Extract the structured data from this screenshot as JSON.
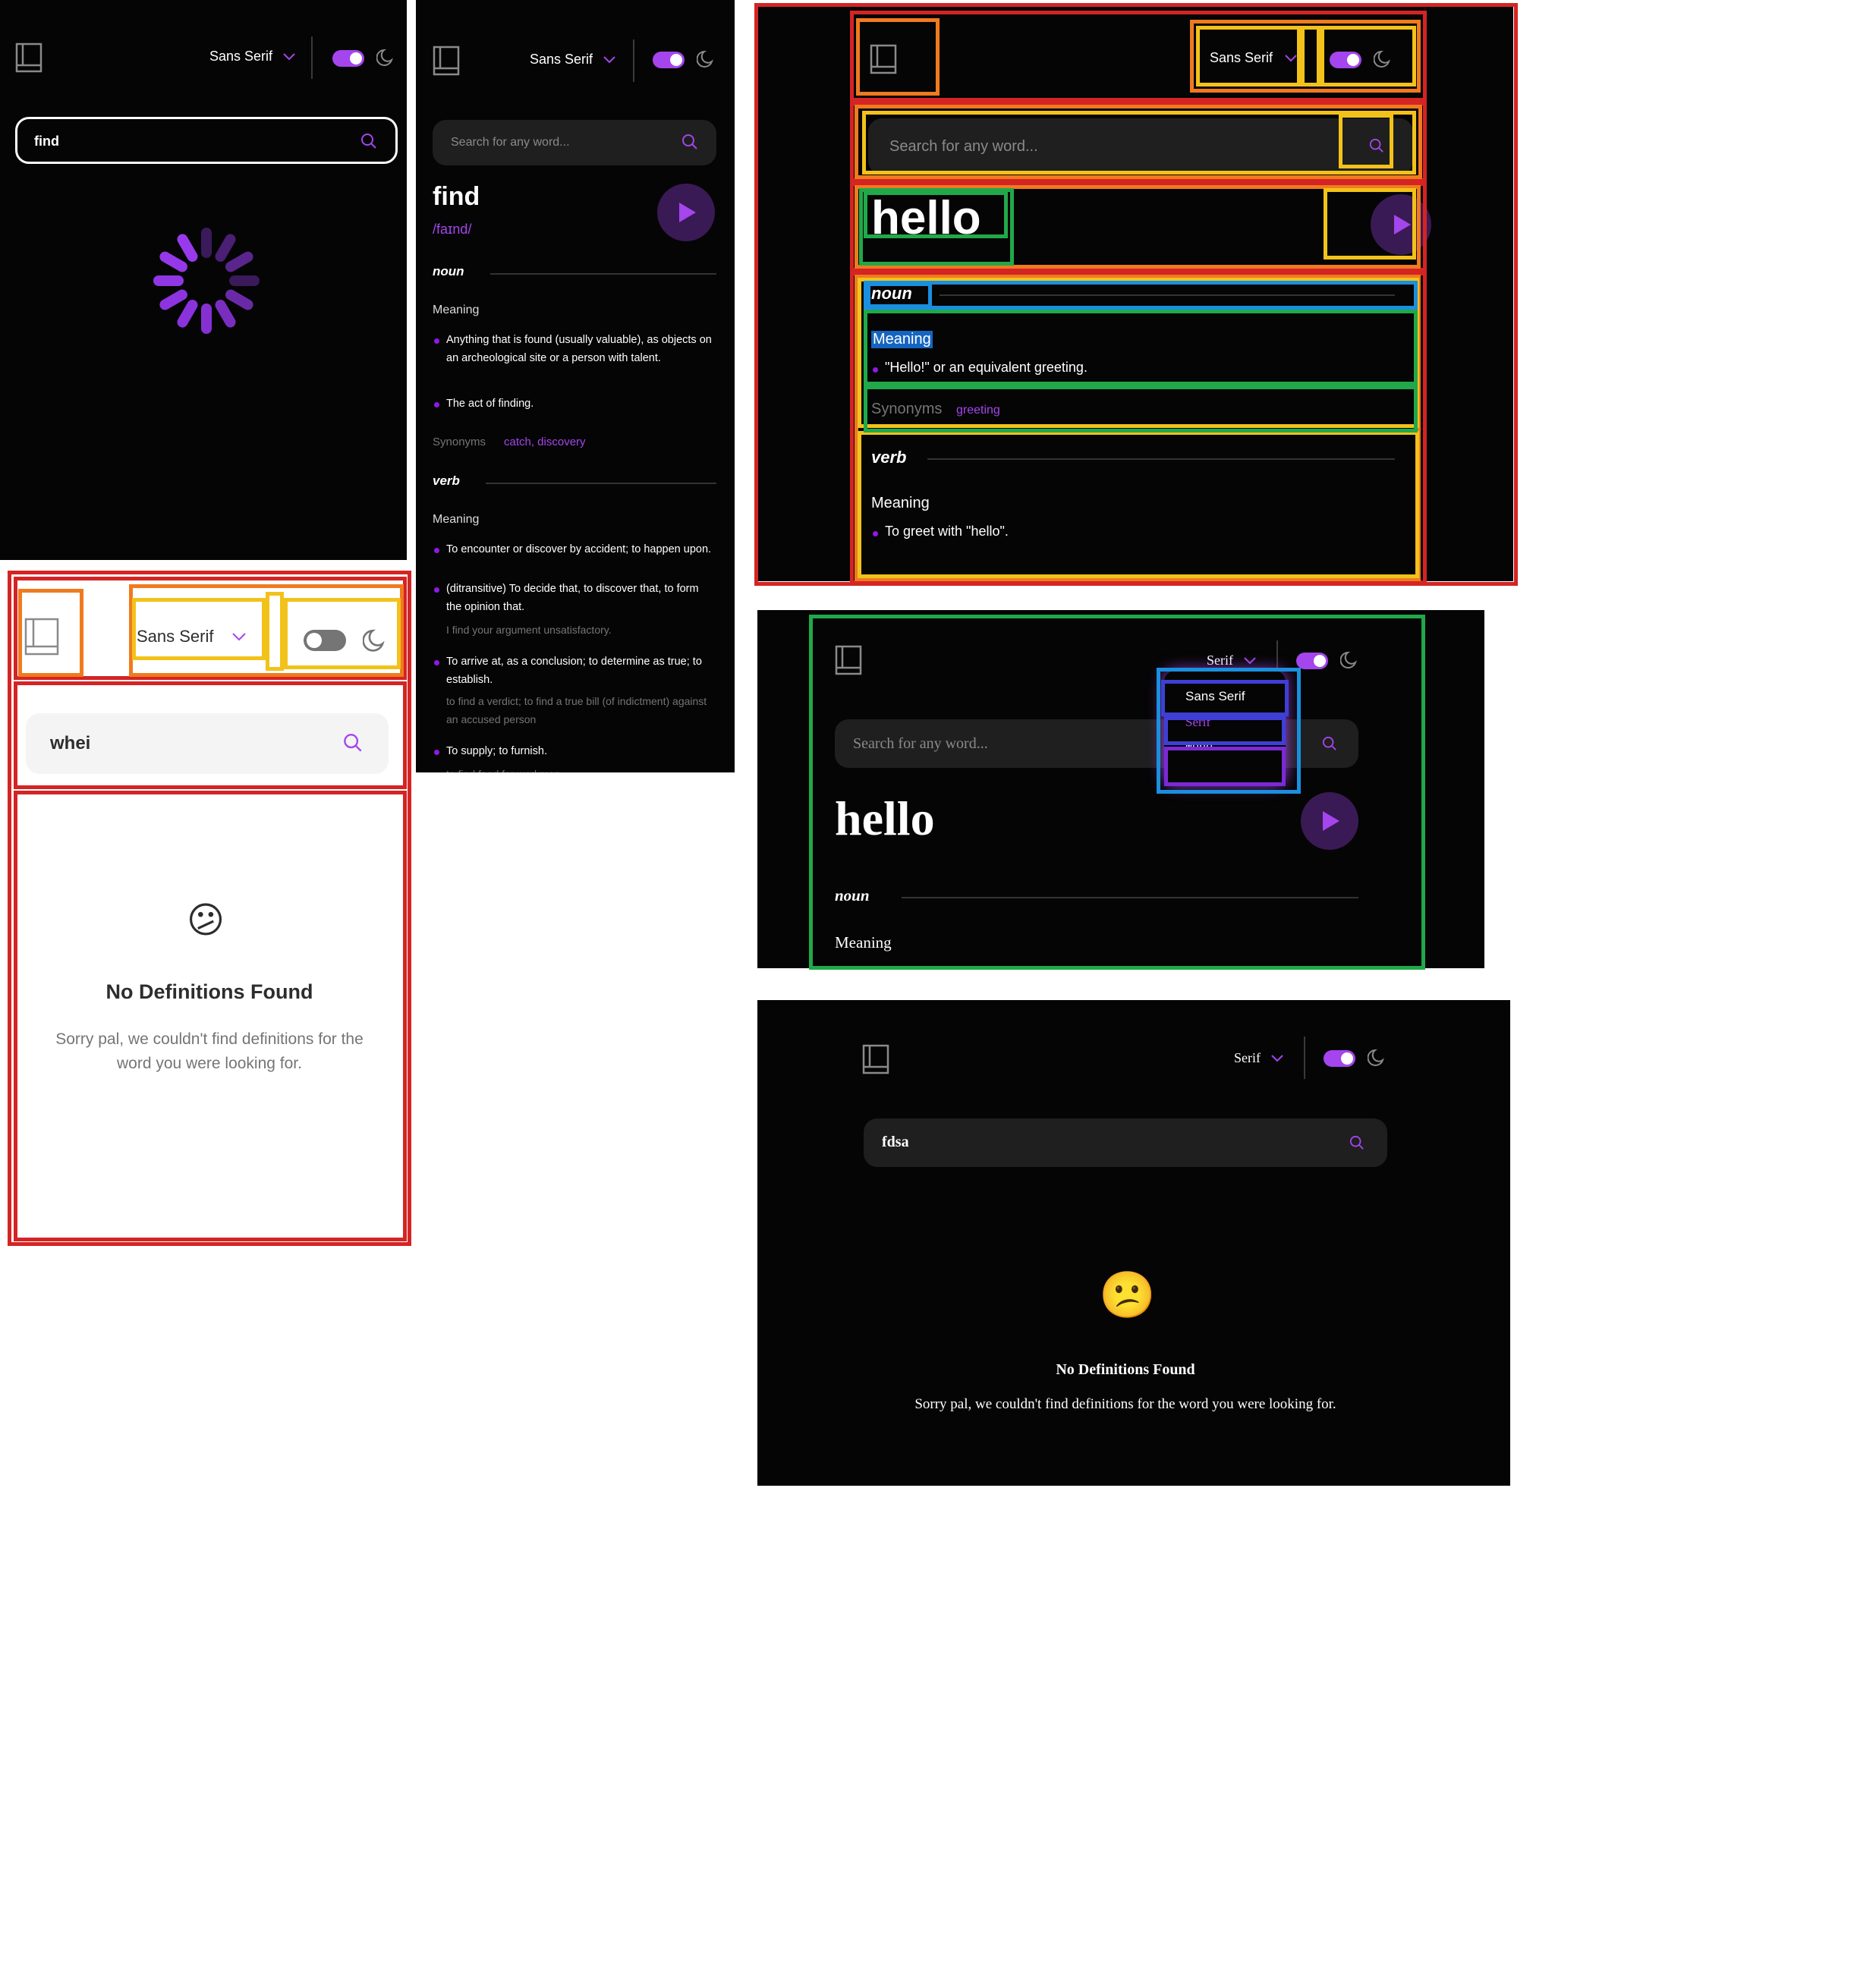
{
  "panel1": {
    "font_label": "Sans Serif",
    "search_value": "find",
    "icons": [
      "book-icon",
      "chevron-down-icon",
      "moon-icon",
      "search-icon",
      "loading-spinner-icon"
    ]
  },
  "panel2": {
    "font_label": "Sans Serif",
    "search_placeholder": "Search for any word...",
    "word": "find",
    "phonetic": "/faɪnd/",
    "noun_label": "noun",
    "meaning_label": "Meaning",
    "noun_defs": [
      "Anything that is found (usually valuable), as objects on an archeological site or a person with talent.",
      "The act of finding."
    ],
    "synonyms_label": "Synonyms",
    "synonyms": "catch, discovery",
    "verb_label": "verb",
    "verb_meaning_label": "Meaning",
    "verb_defs": [
      "To encounter or discover by accident; to happen upon.",
      "(ditransitive) To decide that, to discover that, to form the opinion that.",
      "To arrive at, as a conclusion; to determine as true; to establish.",
      "To supply; to furnish."
    ],
    "verb_examples": [
      "I find your argument unsatisfactory.",
      "to find a verdict; to find a true bill (of indictment) against an accused person",
      "to find food for workmen"
    ]
  },
  "panel3": {
    "font_label": "Sans Serif",
    "search_value": "whei",
    "emoji": "😕",
    "title": "No Definitions Found",
    "message": "Sorry pal, we couldn't find definitions for the word you were looking for."
  },
  "panel4": {
    "font_label": "Sans Serif",
    "search_placeholder": "Search for any word...",
    "word": "hello",
    "noun_label": "noun",
    "meaning_label": "Meaning",
    "noun_defs": [
      "\"Hello!\" or an equivalent greeting."
    ],
    "synonyms_label": "Synonyms",
    "synonyms": "greeting",
    "verb_label": "verb",
    "verb_meaning_label": "Meaning",
    "verb_defs": [
      "To greet with \"hello\"."
    ]
  },
  "panel5": {
    "font_label": "Serif",
    "search_placeholder": "Search for any word...",
    "dropdown_options": [
      "Sans Serif",
      "Serif",
      "Mono"
    ],
    "word": "hello",
    "noun_label": "noun",
    "meaning_label": "Meaning"
  },
  "panel6": {
    "font_label": "Serif",
    "search_value": "fdsa",
    "emoji": "😕",
    "title": "No Definitions Found",
    "message": "Sorry pal, we couldn't find definitions for the word you were looking for."
  },
  "colors": {
    "accent": "#a445ed",
    "dark_bg": "#050505",
    "input_dark": "#1f1f1f",
    "annot_red": "#d42424",
    "annot_orange": "#f07a1e",
    "annot_yellow": "#f2c21a",
    "annot_green": "#21a84a",
    "annot_blue": "#1a8fe0",
    "annot_indigo": "#3f3fd6"
  }
}
